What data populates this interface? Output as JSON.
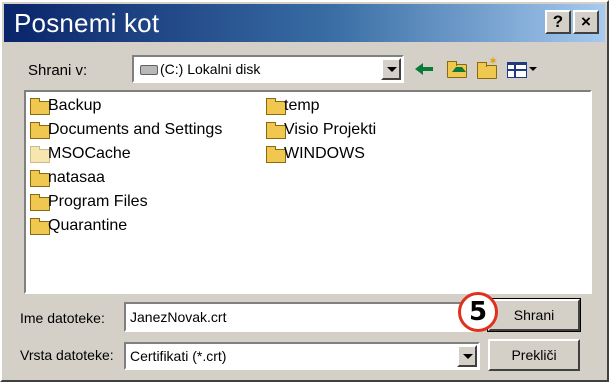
{
  "window": {
    "title": "Posnemi kot",
    "help_label": "?",
    "close_label": "×"
  },
  "toolbar": {
    "save_in_label": "Shrani v:",
    "location_value": "(C:) Lokalni disk",
    "icons": [
      "back-icon",
      "up-folder-icon",
      "new-folder-icon",
      "views-menu-icon"
    ]
  },
  "file_list": {
    "column1": [
      "Backup",
      "Documents and Settings",
      "MSOCache",
      "natasaa",
      "Program Files",
      "Quarantine"
    ],
    "column2": [
      "temp",
      "Visio Projekti",
      "WINDOWS"
    ]
  },
  "form": {
    "filename_label": "Ime datoteke:",
    "filename_value": "JanezNovak.crt",
    "filetype_label": "Vrsta datoteke:",
    "filetype_value": "Certifikati (*.crt)"
  },
  "buttons": {
    "save_label": "Shrani",
    "cancel_label": "Prekliči"
  },
  "annotation": {
    "step_number": "5",
    "color": "#e0301e"
  },
  "colors": {
    "titlebar_start": "#0a246a",
    "titlebar_end": "#a6caf0",
    "dialog_bg": "#d4d0c8"
  }
}
